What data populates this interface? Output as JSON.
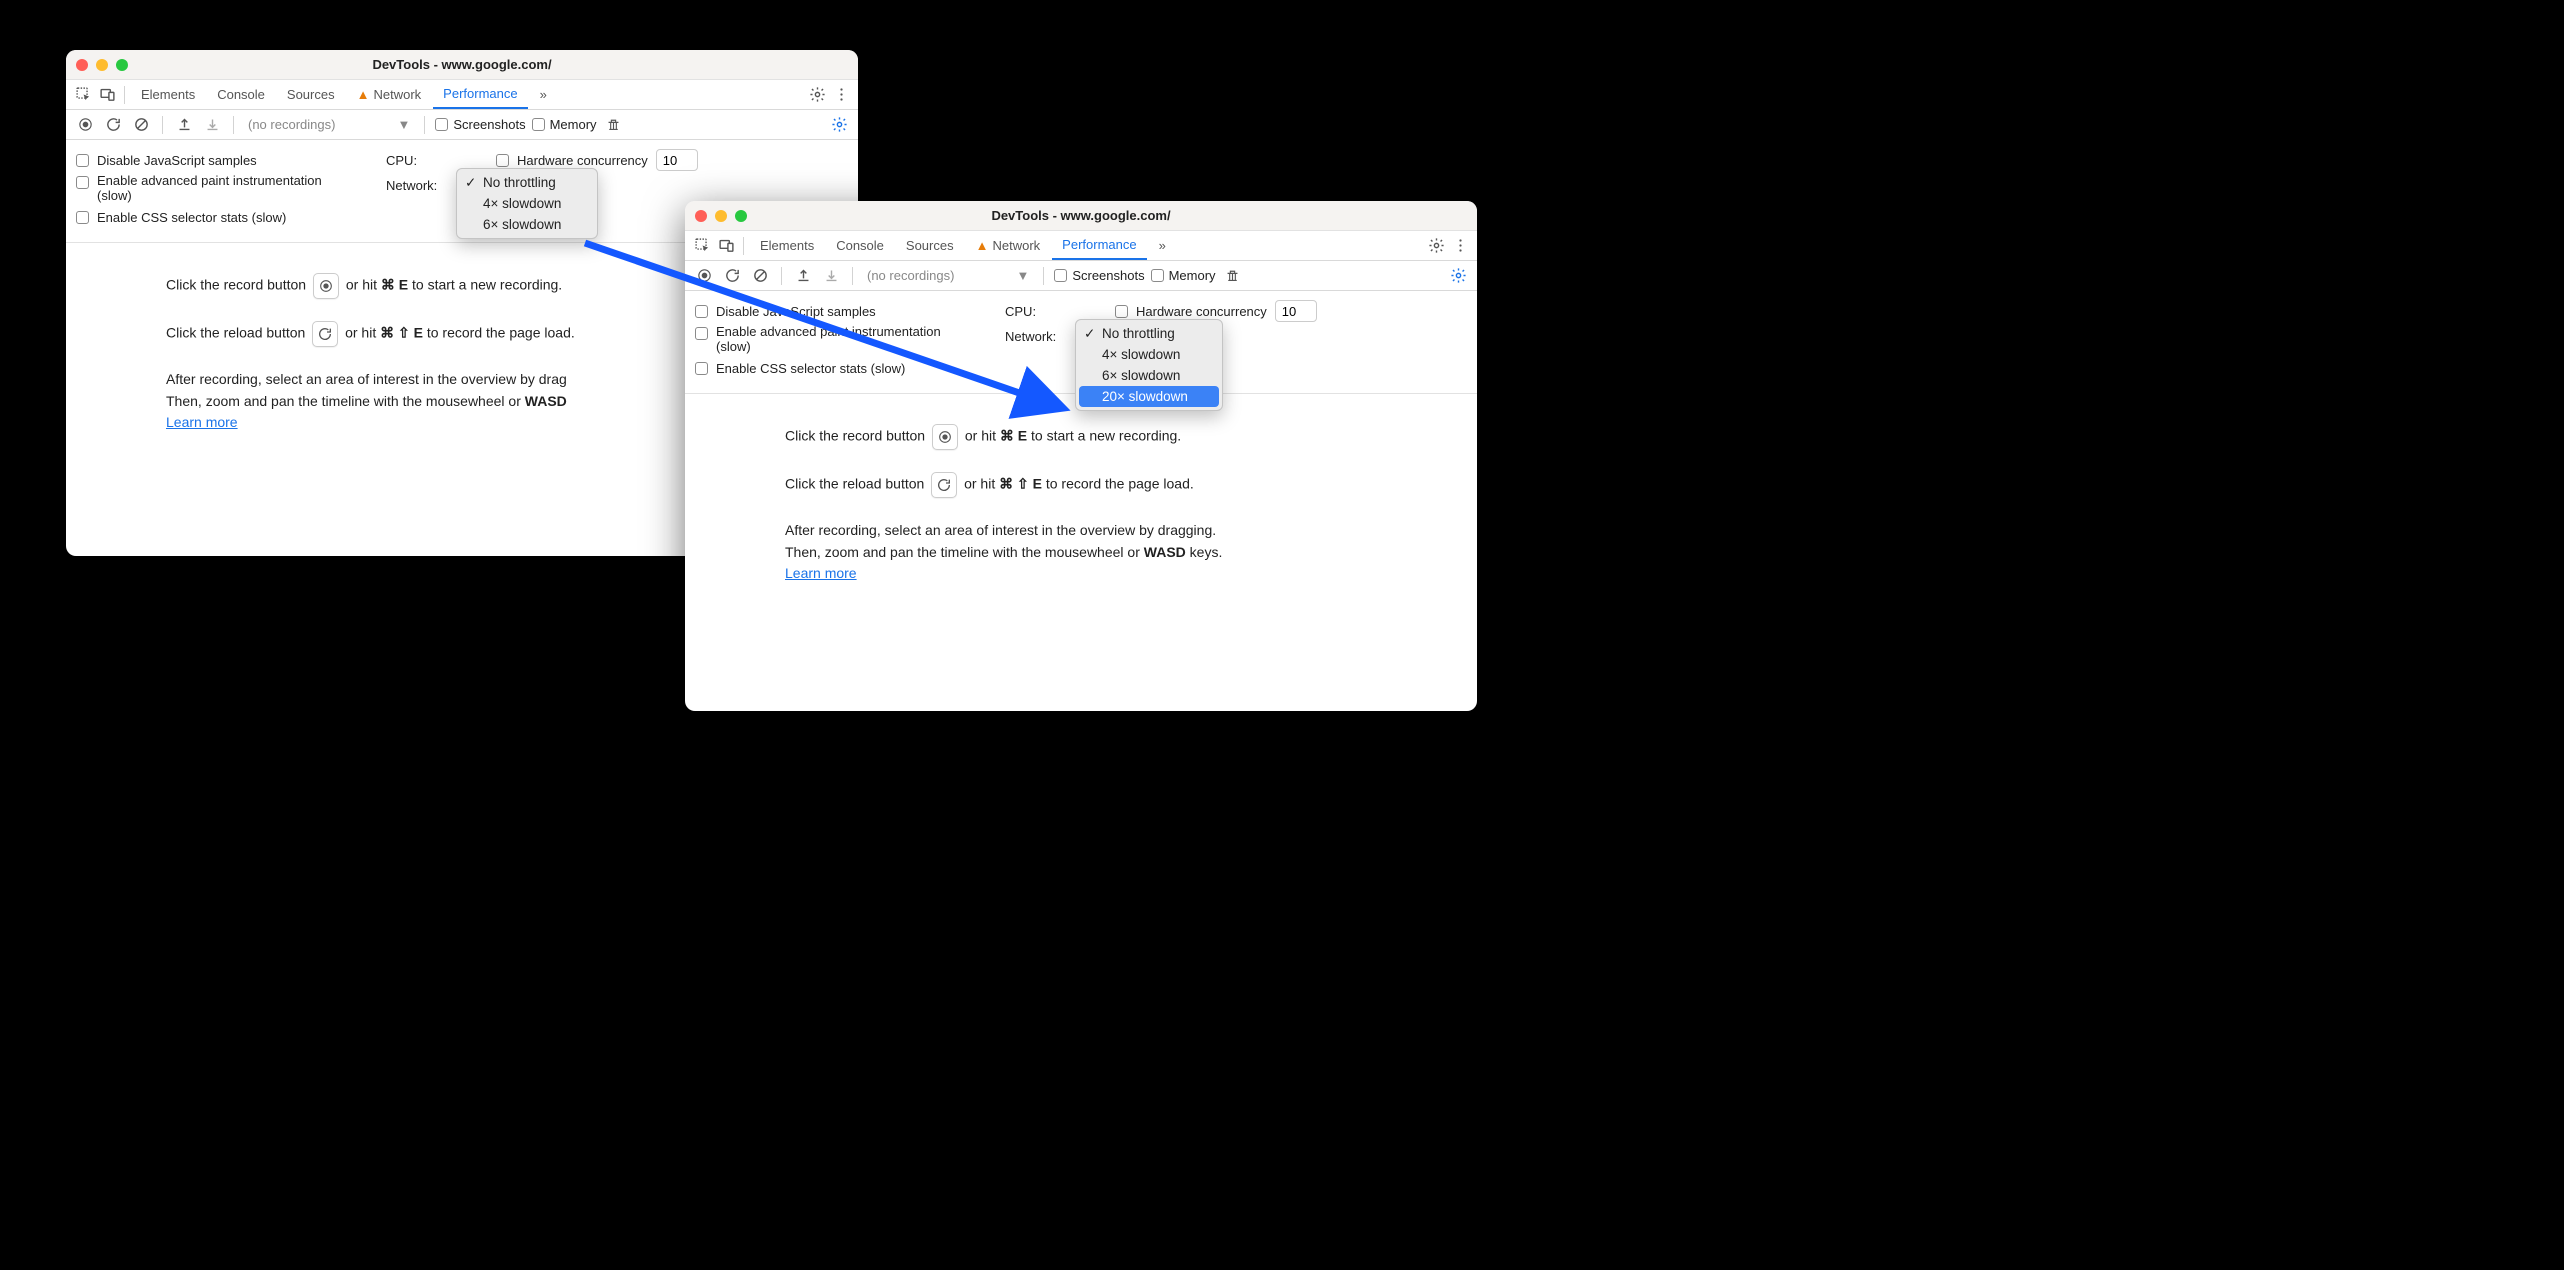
{
  "window_title": "DevTools - www.google.com/",
  "tabs": {
    "elements": "Elements",
    "console": "Console",
    "sources": "Sources",
    "network": "Network",
    "performance": "Performance",
    "more": "»"
  },
  "toolbar": {
    "recordings_placeholder": "(no recordings)",
    "screenshots": "Screenshots",
    "memory": "Memory"
  },
  "settings": {
    "disable_js": "Disable JavaScript samples",
    "adv_paint": "Enable advanced paint instrumentation (slow)",
    "css_stats": "Enable CSS selector stats (slow)",
    "cpu_label": "CPU:",
    "network_label": "Network:",
    "hw_conc": "Hardware concurrency",
    "hw_value": "10"
  },
  "dropdowns": {
    "cpu_a": [
      {
        "label": "No throttling",
        "sel": true
      },
      {
        "label": "4× slowdown"
      },
      {
        "label": "6× slowdown"
      }
    ],
    "cpu_b": [
      {
        "label": "No throttling",
        "sel": true
      },
      {
        "label": "4× slowdown"
      },
      {
        "label": "6× slowdown"
      },
      {
        "label": "20× slowdown",
        "hl": true
      }
    ]
  },
  "hints": {
    "record_pre": "Click the record button ",
    "record_post": " or hit ",
    "record_key1": "⌘",
    "record_key2": "E",
    "record_end": " to start a new recording.",
    "reload_pre": "Click the reload button ",
    "reload_post": " or hit ",
    "reload_key1": "⌘",
    "reload_key2": "⇧",
    "reload_key3": "E",
    "reload_end": " to record the page load.",
    "after1_a": "After recording, select an area of interest in the overview by drag",
    "after1_b": "After recording, select an area of interest in the overview by dragging.",
    "after2_pre": "Then, zoom and pan the timeline with the mousewheel or ",
    "after2_key": "WASD",
    "after2_end_a": "",
    "after2_end_b": " keys.",
    "learn": "Learn more"
  }
}
